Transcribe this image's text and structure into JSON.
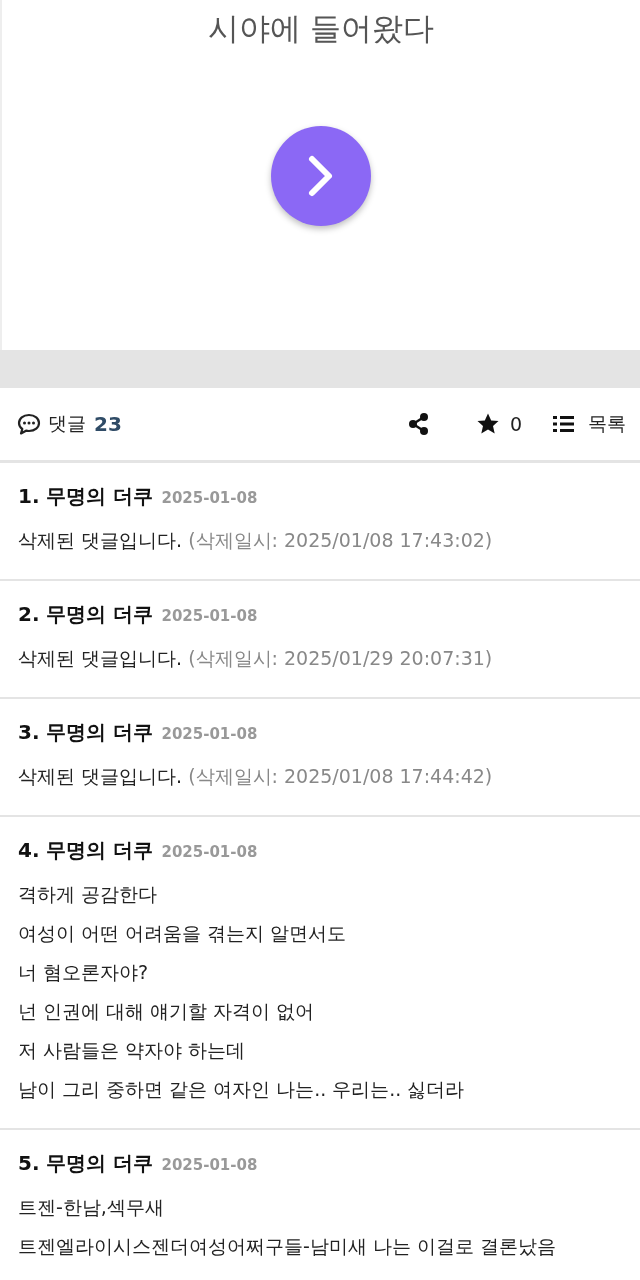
{
  "post": {
    "title": "시야에 들어왔다"
  },
  "toolbar": {
    "comments_label": "댓글",
    "comments_count": "23",
    "favorite_count": "0",
    "list_label": "목록"
  },
  "comments": [
    {
      "number": "1.",
      "author": "무명의 더쿠",
      "date": "2025-01-08",
      "kind": "deleted",
      "lines": [
        "삭제된 댓글입니다."
      ],
      "note": "(삭제일시: 2025/01/08 17:43:02)"
    },
    {
      "number": "2.",
      "author": "무명의 더쿠",
      "date": "2025-01-08",
      "kind": "deleted",
      "lines": [
        "삭제된 댓글입니다."
      ],
      "note": "(삭제일시: 2025/01/29 20:07:31)"
    },
    {
      "number": "3.",
      "author": "무명의 더쿠",
      "date": "2025-01-08",
      "kind": "deleted",
      "lines": [
        "삭제된 댓글입니다."
      ],
      "note": "(삭제일시: 2025/01/08 17:44:42)"
    },
    {
      "number": "4.",
      "author": "무명의 더쿠",
      "date": "2025-01-08",
      "kind": "text",
      "lines": [
        "격하게 공감한다",
        "여성이 어떤 어려움을 겪는지 알면서도",
        "너 혐오론자야?",
        "넌 인권에 대해 얘기할 자격이 없어",
        "저 사람들은 약자야 하는데",
        "남이 그리 중하면 같은 여자인 나는.. 우리는.. 싫더라"
      ]
    },
    {
      "number": "5.",
      "author": "무명의 더쿠",
      "date": "2025-01-08",
      "kind": "text",
      "lines": [
        "트젠-한남,섹무새",
        "트젠엘라이시스젠더여성어쩌구들-남미새 나는 이걸로 결론났음"
      ]
    }
  ]
}
